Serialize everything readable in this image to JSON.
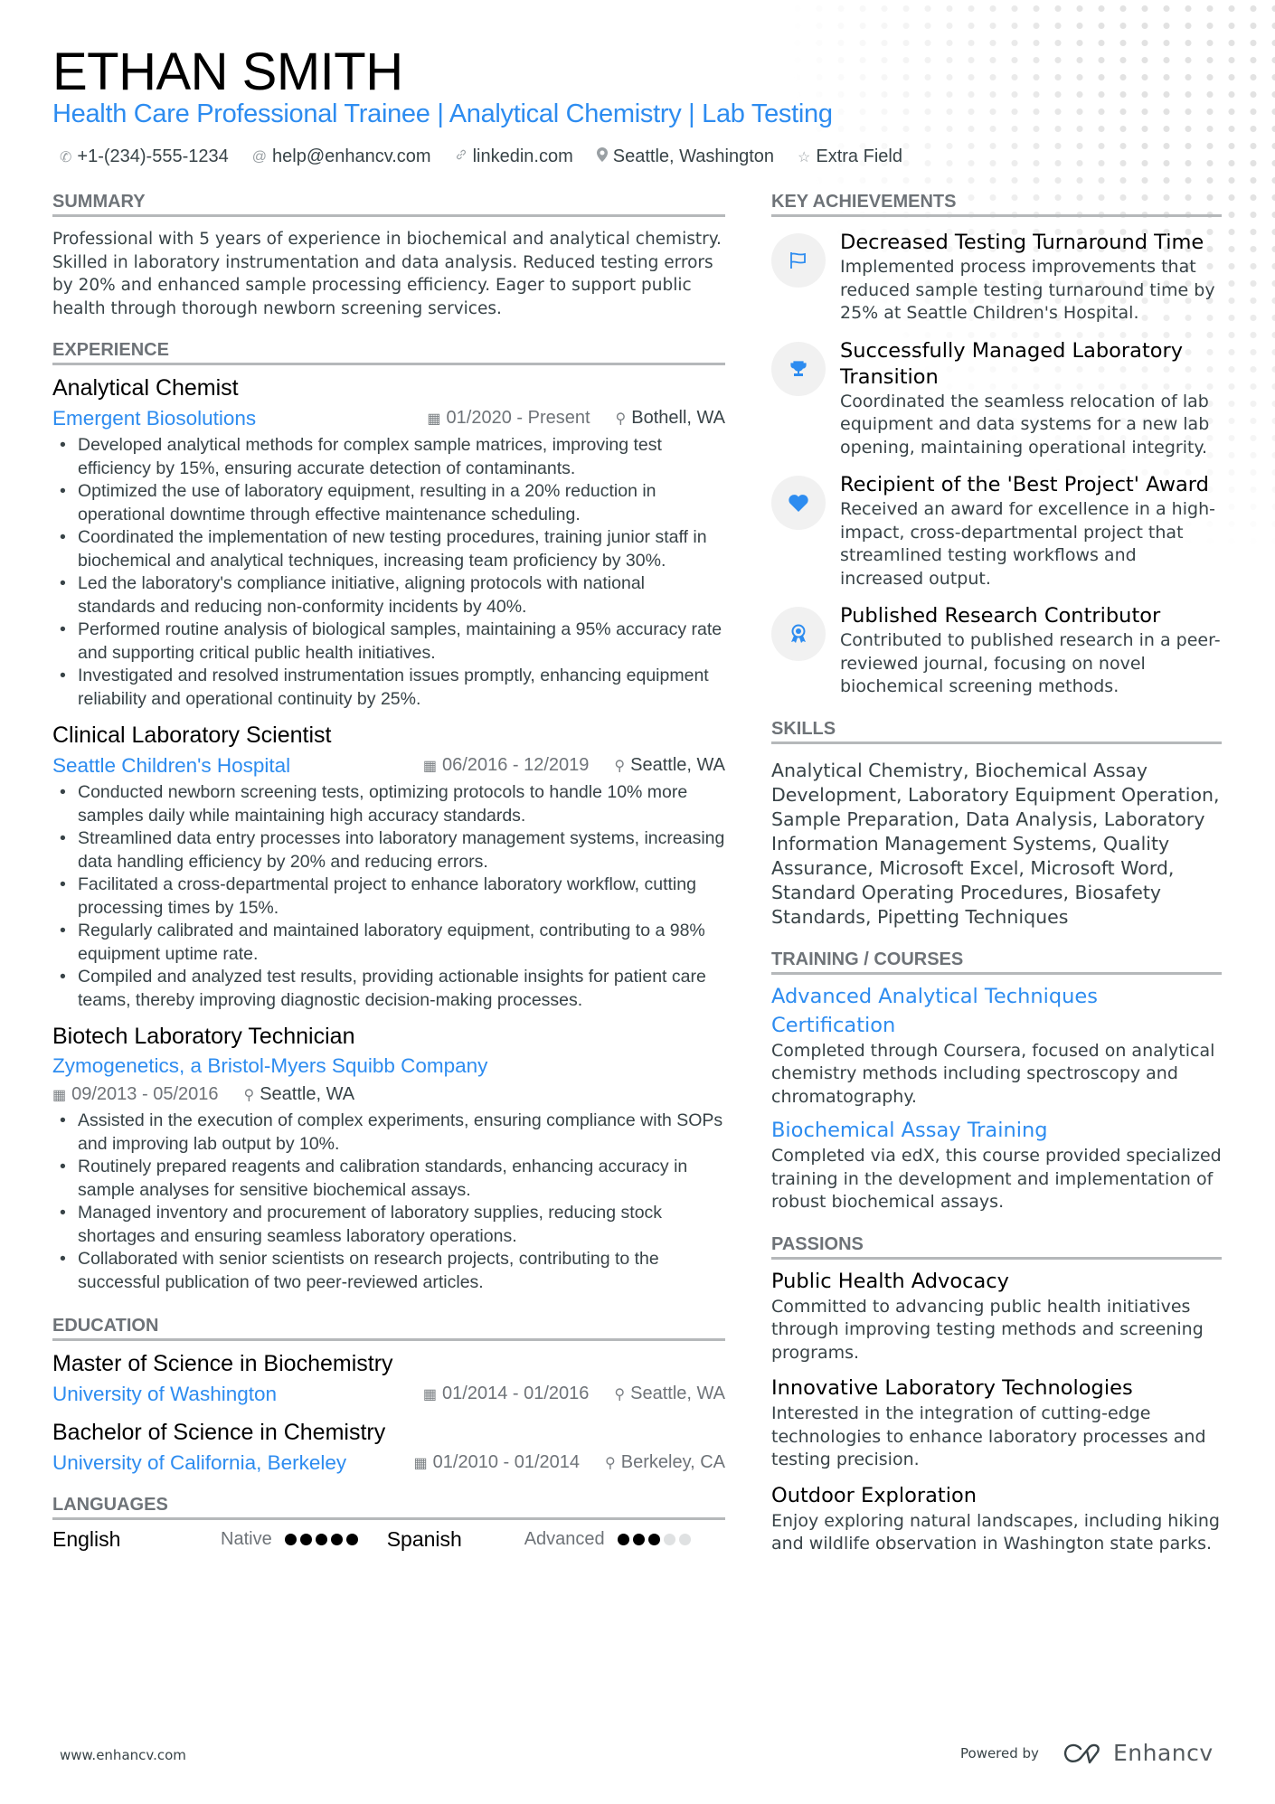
{
  "header": {
    "name": "ETHAN SMITH",
    "title": "Health Care Professional Trainee | Analytical Chemistry | Lab Testing",
    "contacts": [
      {
        "icon": "phone-icon",
        "glyph": "✆",
        "text": "+1-(234)-555-1234"
      },
      {
        "icon": "at-icon",
        "glyph": "@",
        "text": "help@enhancv.com"
      },
      {
        "icon": "link-icon",
        "glyph": "🔗",
        "text": "linkedin.com"
      },
      {
        "icon": "location-icon",
        "glyph": "⚲",
        "text": "Seattle, Washington"
      },
      {
        "icon": "star-icon",
        "glyph": "☆",
        "text": "Extra Field"
      }
    ]
  },
  "summary": {
    "heading": "SUMMARY",
    "text": "Professional with 5 years of experience in biochemical and analytical chemistry. Skilled in laboratory instrumentation and data analysis. Reduced testing errors by 20% and enhanced sample processing efficiency. Eager to support public health through thorough newborn screening services."
  },
  "experience": {
    "heading": "EXPERIENCE",
    "items": [
      {
        "title": "Analytical Chemist",
        "company": "Emergent Biosolutions",
        "dates": "01/2020 - Present",
        "location": "Bothell, WA",
        "bullets": [
          "Developed analytical methods for complex sample matrices, improving test efficiency by 15%, ensuring accurate detection of contaminants.",
          "Optimized the use of laboratory equipment, resulting in a 20% reduction in operational downtime through effective maintenance scheduling.",
          "Coordinated the implementation of new testing procedures, training junior staff in biochemical and analytical techniques, increasing team proficiency by 30%.",
          "Led the laboratory's compliance initiative, aligning protocols with national standards and reducing non-conformity incidents by 40%.",
          "Performed routine analysis of biological samples, maintaining a 95% accuracy rate and supporting critical public health initiatives.",
          "Investigated and resolved instrumentation issues promptly, enhancing equipment reliability and operational continuity by 25%."
        ]
      },
      {
        "title": "Clinical Laboratory Scientist",
        "company": "Seattle Children's Hospital",
        "dates": "06/2016 - 12/2019",
        "location": "Seattle, WA",
        "bullets": [
          "Conducted newborn screening tests, optimizing protocols to handle 10% more samples daily while maintaining high accuracy standards.",
          "Streamlined data entry processes into laboratory management systems, increasing data handling efficiency by 20% and reducing errors.",
          "Facilitated a cross-departmental project to enhance laboratory workflow, cutting processing times by 15%.",
          "Regularly calibrated and maintained laboratory equipment, contributing to a 98% equipment uptime rate.",
          "Compiled and analyzed test results, providing actionable insights for patient care teams, thereby improving diagnostic decision-making processes."
        ]
      },
      {
        "title": "Biotech Laboratory Technician",
        "company": "Zymogenetics, a Bristol-Myers Squibb Company",
        "dates": "09/2013 - 05/2016",
        "location": "Seattle, WA",
        "bullets": [
          "Assisted in the execution of complex experiments, ensuring compliance with SOPs and improving lab output by 10%.",
          "Routinely prepared reagents and calibration standards, enhancing accuracy in sample analyses for sensitive biochemical assays.",
          "Managed inventory and procurement of laboratory supplies, reducing stock shortages and ensuring seamless laboratory operations.",
          "Collaborated with senior scientists on research projects, contributing to the successful publication of two peer-reviewed articles."
        ]
      }
    ]
  },
  "education": {
    "heading": "EDUCATION",
    "items": [
      {
        "degree": "Master of Science in Biochemistry",
        "school": "University of Washington",
        "dates": "01/2014 - 01/2016",
        "location": "Seattle, WA"
      },
      {
        "degree": "Bachelor of Science in Chemistry",
        "school": "University of California, Berkeley",
        "dates": "01/2010 - 01/2014",
        "location": "Berkeley, CA"
      }
    ]
  },
  "languages": {
    "heading": "LANGUAGES",
    "items": [
      {
        "name": "English",
        "level": "Native",
        "rating": 5,
        "max": 5
      },
      {
        "name": "Spanish",
        "level": "Advanced",
        "rating": 3,
        "max": 5
      }
    ]
  },
  "achievements": {
    "heading": "KEY ACHIEVEMENTS",
    "items": [
      {
        "icon": "flag-icon",
        "title": "Decreased Testing Turnaround Time",
        "desc": "Implemented process improvements that reduced sample testing turnaround time by 25% at Seattle Children's Hospital."
      },
      {
        "icon": "trophy-icon",
        "title": "Successfully Managed Laboratory Transition",
        "desc": "Coordinated the seamless relocation of lab equipment and data systems for a new lab opening, maintaining operational integrity."
      },
      {
        "icon": "heart-icon",
        "title": "Recipient of the 'Best Project' Award",
        "desc": "Received an award for excellence in a high-impact, cross-departmental project that streamlined testing workflows and increased output."
      },
      {
        "icon": "medal-icon",
        "title": "Published Research Contributor",
        "desc": "Contributed to published research in a peer-reviewed journal, focusing on novel biochemical screening methods."
      }
    ]
  },
  "skills": {
    "heading": "SKILLS",
    "text": "Analytical Chemistry, Biochemical Assay Development, Laboratory Equipment Operation, Sample Preparation, Data Analysis, Laboratory Information Management Systems, Quality Assurance, Microsoft Excel, Microsoft Word, Standard Operating Procedures, Biosafety Standards, Pipetting Techniques"
  },
  "training": {
    "heading": "TRAINING / COURSES",
    "items": [
      {
        "title": "Advanced Analytical Techniques Certification",
        "desc": "Completed through Coursera, focused on analytical chemistry methods including spectroscopy and chromatography."
      },
      {
        "title": "Biochemical Assay Training",
        "desc": "Completed via edX, this course provided specialized training in the development and implementation of robust biochemical assays."
      }
    ]
  },
  "passions": {
    "heading": "PASSIONS",
    "items": [
      {
        "title": "Public Health Advocacy",
        "desc": "Committed to advancing public health initiatives through improving testing methods and screening programs."
      },
      {
        "title": "Innovative Laboratory Technologies",
        "desc": "Interested in the integration of cutting-edge technologies to enhance laboratory processes and testing precision."
      },
      {
        "title": "Outdoor Exploration",
        "desc": "Enjoy exploring natural landscapes, including hiking and wildlife observation in Washington state parks."
      }
    ]
  },
  "footer": {
    "website": "www.enhancv.com",
    "powered_by": "Powered by",
    "brand": "Enhancv"
  },
  "colors": {
    "accent": "#2d8cf0",
    "text": "#384347",
    "heading_rule": "#b5b8ba"
  }
}
